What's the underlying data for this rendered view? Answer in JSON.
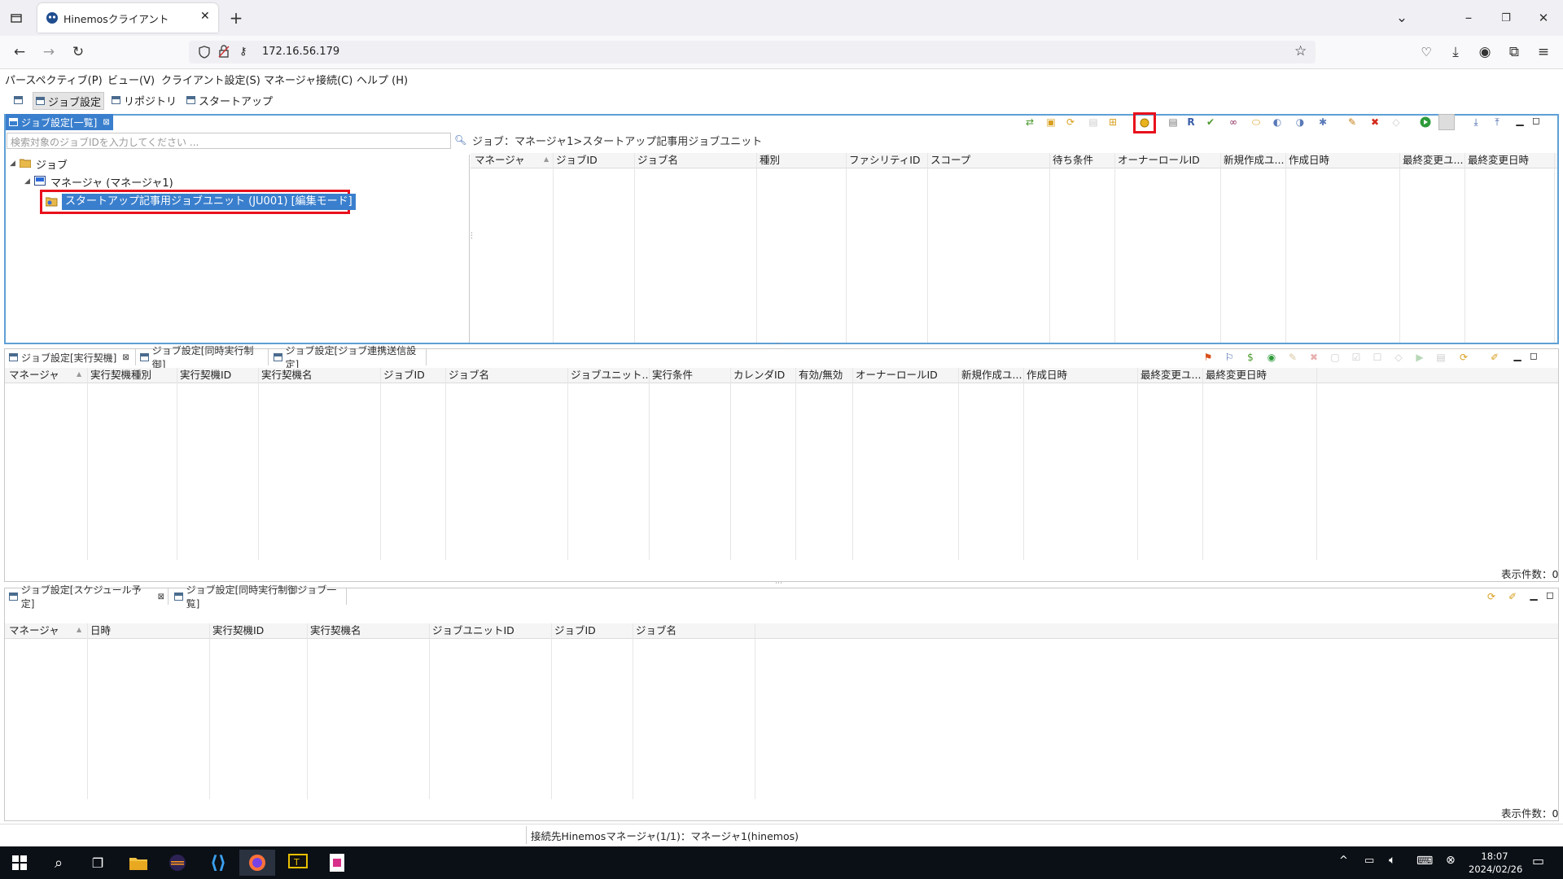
{
  "browser": {
    "tab_title": "Hinemosクライアント",
    "url": "172.16.56.179"
  },
  "menu": [
    "パースペクティブ(P)",
    "ビュー(V)",
    "クライアント設定(S)",
    "マネージャ接続(C)",
    "ヘルプ (H)"
  ],
  "perspectives": [
    "ジョブ設定",
    "リポジトリ",
    "スタートアップ"
  ],
  "top_panel": {
    "tab_label": "ジョブ設定[一覧]",
    "search_placeholder": "検索対象のジョブIDを入力してください ...",
    "breadcrumb": "ジョブ：マネージャ1>スタートアップ記事用ジョブユニット",
    "tree": {
      "root": "ジョブ",
      "manager": "マネージャ (マネージャ1)",
      "unit": "スタートアップ記事用ジョブユニット (JU001) [編集モード]"
    },
    "columns": [
      "マネージャ",
      "ジョブID",
      "ジョブ名",
      "種別",
      "ファシリティID",
      "スコープ",
      "待ち条件",
      "オーナーロールID",
      "新規作成ユ...",
      "作成日時",
      "最終変更ユ...",
      "最終変更日時"
    ]
  },
  "middle_panel": {
    "tabs": [
      "ジョブ設定[実行契機]",
      "ジョブ設定[同時実行制御]",
      "ジョブ設定[ジョブ連携送信設定]"
    ],
    "columns": [
      "マネージャ",
      "実行契機種別",
      "実行契機ID",
      "実行契機名",
      "ジョブID",
      "ジョブ名",
      "ジョブユニット...",
      "実行条件",
      "カレンダID",
      "有効/無効",
      "オーナーロールID",
      "新規作成ユ...",
      "作成日時",
      "最終変更ユ...",
      "最終変更日時"
    ],
    "count": "表示件数：0"
  },
  "bottom_panel": {
    "tabs": [
      "ジョブ設定[スケジュール予定]",
      "ジョブ設定[同時実行制御ジョブ一覧]"
    ],
    "columns": [
      "マネージャ",
      "日時",
      "実行契機ID",
      "実行契機名",
      "ジョブユニットID",
      "ジョブID",
      "ジョブ名"
    ],
    "count": "表示件数：0"
  },
  "status_bar": "接続先Hinemosマネージャ(1/1)：マネージャ1(hinemos)",
  "taskbar": {
    "time": "18:07",
    "date": "2024/02/26"
  },
  "colors": {
    "active_tab": "#3a7fcd",
    "active_border": "#5fa0d6",
    "highlight_box": "#e8101c",
    "selection": "#3a7fcd"
  }
}
